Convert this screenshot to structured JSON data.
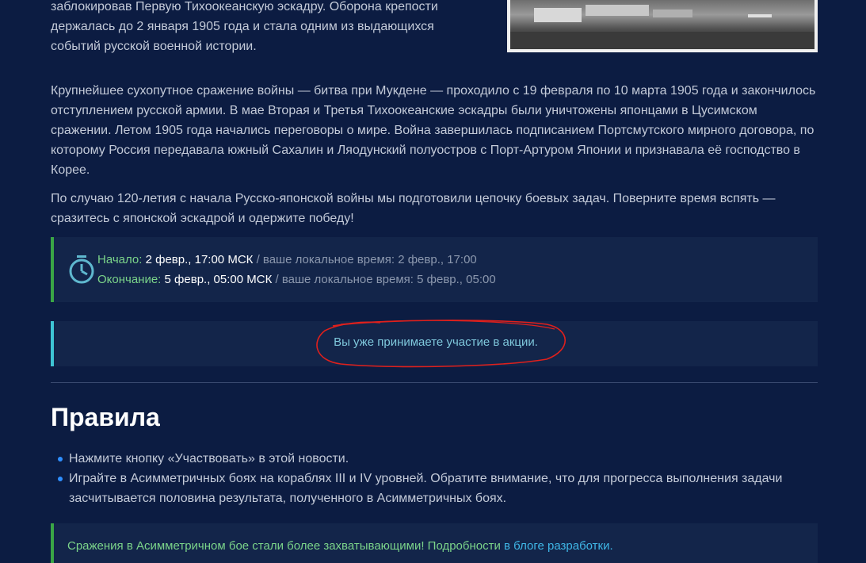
{
  "intro_text": "заблокировав Первую Тихоокеанскую эскадру. Оборона крепости держалась до 2 января 1905 года и стала одним из выдающихся событий русской военной истории.",
  "paragraph_2": "Крупнейшее сухопутное сражение войны — битва при Мукдене — проходило с 19 февраля по 10 марта 1905 года и закончилось отступлением русской армии. В мае Вторая и Третья Тихоокеанские эскадры были уничтожены японцами в Цусимском сражении. Летом 1905 года начались переговоры о мире. Война завершилась подписанием Портсмутского мирного договора, по которому Россия передавала южный Сахалин и Ляодунский полуостров с Порт-Артуром Японии и признавала её господство в Корее.",
  "paragraph_3": "По случаю 120-летия с начала Русско-японской войны мы подготовили цепочку боевых задач. Поверните время вспять — сразитесь с японской эскадрой и одержите победу!",
  "timer": {
    "icon": "stopwatch-icon",
    "start_label": "Начало:",
    "start_value": "2 февр., 17:00 МСК",
    "start_local": "/ ваше локальное время: 2 февр., 17:00",
    "end_label": "Окончание:",
    "end_value": "5 февр., 05:00 МСК",
    "end_local": "/ ваше локальное время: 5 февр., 05:00"
  },
  "status_message": "Вы уже принимаете участие в акции.",
  "rules": {
    "heading": "Правила",
    "items": [
      "Нажмите кнопку «Участвовать» в этой новости.",
      "Играйте в Асимметричных боях на кораблях III и IV уровней. Обратите внимание, что для прогресса выполнения задачи засчитывается половина результата, полученного в Асимметричных боях."
    ]
  },
  "note": {
    "text": "Сражения в Асимметричном бое стали более захватывающими! Подробности ",
    "link": "в блоге разработки."
  },
  "colors": {
    "background": "#0c1c42",
    "box": "#13254a",
    "accent_green": "#3aa646",
    "accent_cyan": "#3ec4d4",
    "bullet": "#2f8fff",
    "annotation": "#e0201c"
  }
}
